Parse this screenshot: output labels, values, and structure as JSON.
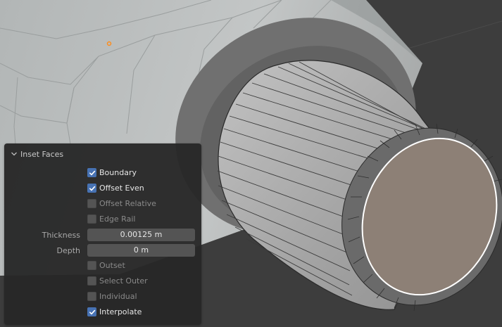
{
  "operator_panel": {
    "title": "Inset Faces",
    "collapse_icon": "chevron-down-icon",
    "checkboxes": [
      {
        "label": "Boundary",
        "checked": true
      },
      {
        "label": "Offset Even",
        "checked": true
      },
      {
        "label": "Offset Relative",
        "checked": false
      },
      {
        "label": "Edge Rail",
        "checked": false
      }
    ],
    "thickness": {
      "label": "Thickness",
      "value": "0.00125 m"
    },
    "depth": {
      "label": "Depth",
      "value": "0 m"
    },
    "checkboxes2": [
      {
        "label": "Outset",
        "checked": false
      },
      {
        "label": "Select Outer",
        "checked": false
      },
      {
        "label": "Individual",
        "checked": false
      },
      {
        "label": "Interpolate",
        "checked": true
      }
    ]
  },
  "colors": {
    "viewport_bg": "#3d3d3d",
    "panel_bg": "#282828",
    "checkbox_on": "#4772b3",
    "selected_face": "#8d8076",
    "mesh_light": "#b9bcbc"
  }
}
